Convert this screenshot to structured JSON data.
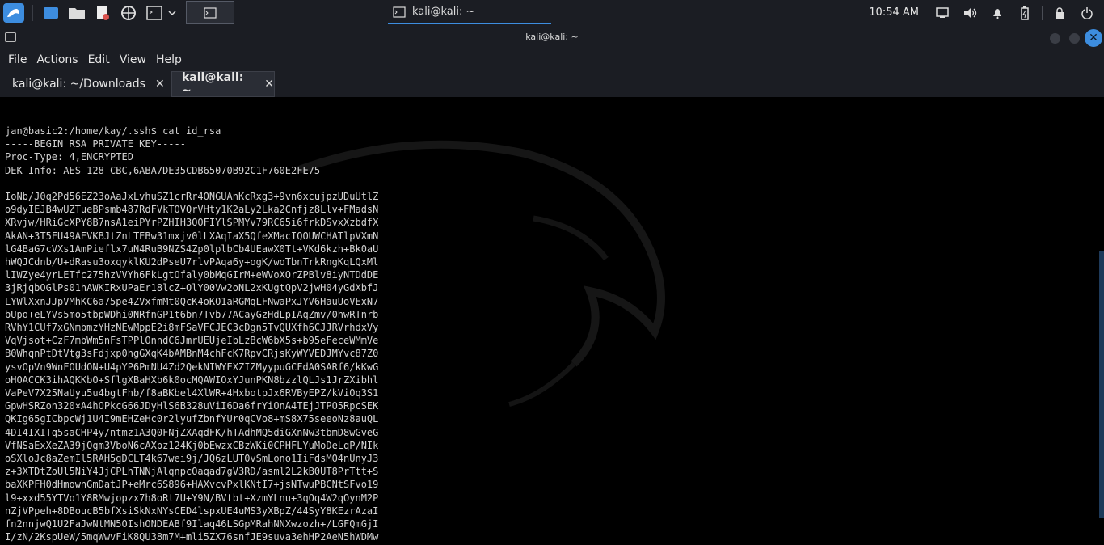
{
  "taskbar": {
    "clock": "10:54 AM",
    "window_task_title": "kali@kali: ~"
  },
  "window": {
    "title": "kali@kali: ~",
    "menu": [
      "File",
      "Actions",
      "Edit",
      "View",
      "Help"
    ],
    "tabs": [
      {
        "label": "kali@kali: ~/Downloads",
        "active": false
      },
      {
        "label": "kali@kali: ~",
        "active": true
      }
    ]
  },
  "terminal": {
    "prompt_line": "jan@basic2:/home/kay/.ssh$ cat id_rsa",
    "header_lines": [
      "-----BEGIN RSA PRIVATE KEY-----",
      "Proc-Type: 4,ENCRYPTED",
      "DEK-Info: AES-128-CBC,6ABA7DE35CDB65070B92C1F760E2FE75"
    ],
    "key_lines": [
      "IoNb/J0q2Pd56EZ23oAaJxLvhuSZ1crRr4ONGUAnKcRxg3+9vn6xcujpzUDuUtlZ",
      "o9dyIEJB4wUZTueBPsmb487RdFVkTOVQrVHty1K2aLy2Lka2Cnfjz8Llv+FMadsN",
      "XRvjw/HRiGcXPY8B7nsA1eiPYrPZHIH3QOFIYlSPMYv79RC65i6frkDSvxXzbdfX",
      "AkAN+3T5FU49AEVKBJtZnLTEBw31mxjv0lLXAqIaX5QfeXMacIQOUWCHATlpVXmN",
      "lG4BaG7cVXs1AmPieflx7uN4RuB9NZS4Zp0lplbCb4UEawX0Tt+VKd6kzh+Bk0aU",
      "hWQJCdnb/U+dRasu3oxqyklKU2dPseU7rlvPAqa6y+ogK/woTbnTrkRngKqLQxMl",
      "lIWZye4yrLETfc275hzVVYh6FkLgtOfaly0bMqGIrM+eWVoXOrZPBlv8iyNTDdDE",
      "3jRjqbOGlPs01hAWKIRxUPaEr18lcZ+OlY00Vw2oNL2xKUgtQpV2jwH04yGdXbfJ",
      "LYWlXxnJJpVMhKC6a75pe4ZVxfmMt0QcK4oKO1aRGMqLFNwaPxJYV6HauUoVExN7",
      "bUpo+eLYVs5mo5tbpWDhi0NRfnGP1t6bn7Tvb77ACayGzHdLpIAqZmv/0hwRTnrb",
      "RVhY1CUf7xGNmbmzYHzNEwMppE2i8mFSaVFCJEC3cDgn5TvQUXfh6CJJRVrhdxVy",
      "VqVjsot+CzF7mbWm5nFsTPPlOnndC6JmrUEUjeIbLzBcW6bX5s+b95eFeceWMmVe",
      "B0WhqnPtDtVtg3sFdjxp0hgGXqK4bAMBnM4chFcK7RpvCRjsKyWYVEDJMYvc87Z0",
      "ysvOpVn9WnFOUdON+U4pYP6PmNU4Zd2QekNIWYEXZIZMyypuGCFdA0SARf6/kKwG",
      "oHOACCK3ihAQKKbO+SflgXBaHXb6k0ocMQAWIOxYJunPKN8bzzlQLJs1JrZXibhl",
      "VaPeV7X25NaUyu5u4bgtFhb/f8aBKbel4XlWR+4HxbotpJx6RVByEPZ/kViOq3S1",
      "GpwHSRZon320×A4hOPkcG66JDyHlS6B328uViI6Da6frYiOnA4TEjJTPO5RpcSEK",
      "QKIg65gICbpcWj1U4I9mEHZeHc0r2lyufZbnfYUr0qCVo8+mS8X75seeoNz8auQL",
      "4DI4IXITq5saCHP4y/ntmz1A3Q0FNjZXAqdFK/hTAdhMQ5diGXnNw3tbmD8wGveG",
      "VfNSaExXeZA39jOgm3VboN6cAXpz124Kj0bEwzxCBzWKi0CPHFLYuMoDeLqP/NIk",
      "oSXloJc8aZemIl5RAH5gDCLT4k67wei9j/JQ6zLUT0vSmLono1IiFdsMO4nUnyJ3",
      "z+3XTDtZoUl5NiY4JjCPLhTNNjAlqnpcOaqad7gV3RD/asml2L2kB0UT8PrTtt+S",
      "baXKPFH0dHmownGmDatJP+eMrc6S896+HAXvcvPxlKNtI7+jsNTwuPBCNtSFvo19",
      "l9+xxd55YTVo1Y8RMwjopzx7h8oRt7U+Y9N/BVtbt+XzmYLnu+3qOq4W2qOynM2P",
      "nZjVPpeh+8DBoucB5bfXsiSkNxNYsCED4lspxUE4uMS3yXBpZ/44SyY8KEzrAzaI",
      "fn2nnjwQ1U2FaJwNtMN5OIshONDEABf9Ilaq46LSGpMRahNNXwzozh+/LGFQmGjI",
      "I/zN/2KspUeW/5mqWwvFiK8QU38m7M+mli5ZX76snfJE9suva3ehHP2AeN5hWDMw"
    ]
  }
}
